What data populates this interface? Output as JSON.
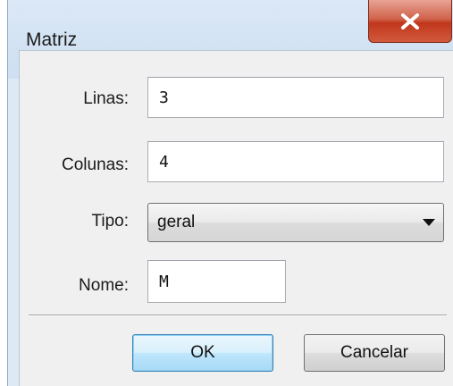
{
  "window": {
    "title": "Matriz"
  },
  "form": {
    "rows_label": "Linas:",
    "rows_value": "3",
    "cols_label": "Colunas:",
    "cols_value": "4",
    "type_label": "Tipo:",
    "type_value": "geral",
    "name_label": "Nome:",
    "name_value": "M"
  },
  "buttons": {
    "ok_label": "OK",
    "cancel_label": "Cancelar"
  },
  "icons": {
    "close": "close-icon",
    "dropdown": "chevron-down-icon"
  },
  "colors": {
    "close_button": "#c1371c",
    "frame": "#dde9f5",
    "default_button_border": "#3c7fb1"
  }
}
